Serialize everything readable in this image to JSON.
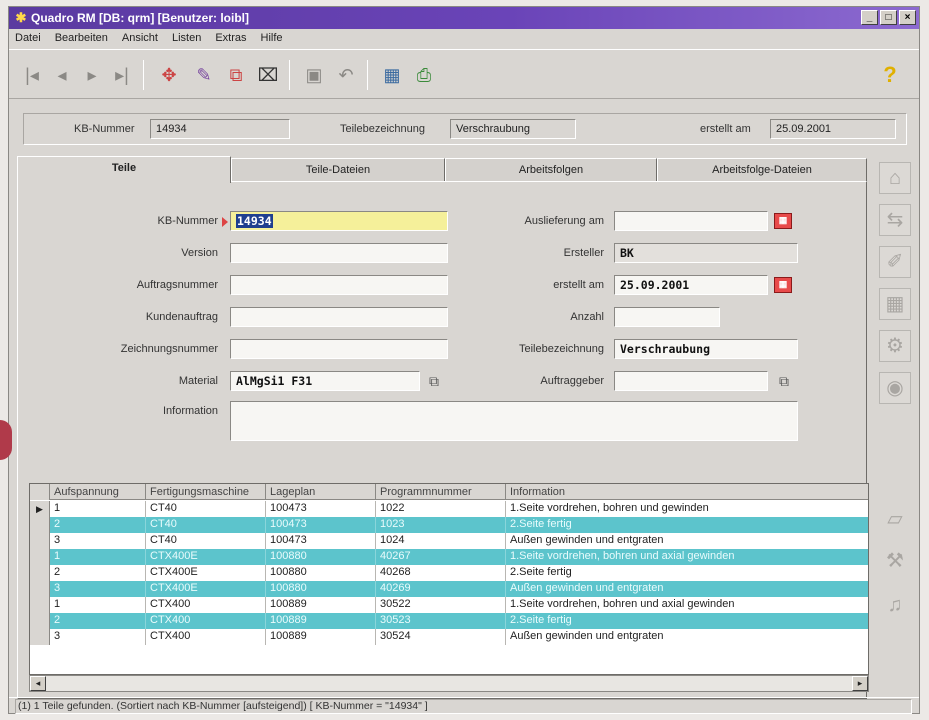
{
  "window": {
    "title": "Quadro RM  [DB: qrm] [Benutzer: loibl]",
    "controls": {
      "minimize": "_",
      "maximize": "□",
      "close": "×"
    }
  },
  "menu": [
    "Datei",
    "Bearbeiten",
    "Ansicht",
    "Listen",
    "Extras",
    "Hilfe"
  ],
  "toolbar": {
    "icons": [
      "first-record-icon",
      "prev-record-icon",
      "next-record-icon",
      "last-record-icon",
      "navigate-icon",
      "edit-icon",
      "copy-icon",
      "delete-icon",
      "save-icon",
      "undo-icon",
      "grid-view-icon",
      "print-icon",
      "help-icon"
    ]
  },
  "infobar": {
    "kb_label": "KB-Nummer",
    "kb_value": "14934",
    "teil_label": "Teilebezeichnung",
    "teil_value": "Verschraubung",
    "erstellt_label": "erstellt am",
    "erstellt_value": "25.09.2001"
  },
  "tabs": [
    "Teile",
    "Teile-Dateien",
    "Arbeitsfolgen",
    "Arbeitsfolge-Dateien"
  ],
  "form": {
    "left": [
      {
        "label": "KB-Nummer",
        "value": "14934"
      },
      {
        "label": "Version",
        "value": ""
      },
      {
        "label": "Auftragsnummer",
        "value": ""
      },
      {
        "label": "Kundenauftrag",
        "value": ""
      },
      {
        "label": "Zeichnungsnummer",
        "value": ""
      },
      {
        "label": "Material",
        "value": "AlMgSi1 F31"
      }
    ],
    "right": [
      {
        "label": "Auslieferung am",
        "value": ""
      },
      {
        "label": "Ersteller",
        "value": "BK"
      },
      {
        "label": "erstellt am",
        "value": "25.09.2001"
      },
      {
        "label": "Anzahl",
        "value": ""
      },
      {
        "label": "Teilebezeichnung",
        "value": "Verschraubung"
      },
      {
        "label": "Auftraggeber",
        "value": ""
      }
    ],
    "information_label": "Information",
    "information_value": ""
  },
  "grid": {
    "columns": [
      "Aufspannung",
      "Fertigungsmaschine",
      "Lageplan",
      "Programmnummer",
      "Information"
    ],
    "rows": [
      [
        "1",
        "CT40",
        "100473",
        "1022",
        "1.Seite vordrehen, bohren und gewinden"
      ],
      [
        "2",
        "CT40",
        "100473",
        "1023",
        "2.Seite fertig"
      ],
      [
        "3",
        "CT40",
        "100473",
        "1024",
        "Außen gewinden und entgraten"
      ],
      [
        "1",
        "CTX400E",
        "100880",
        "40267",
        "1.Seite vordrehen, bohren und axial gewinden"
      ],
      [
        "2",
        "CTX400E",
        "100880",
        "40268",
        "2.Seite fertig"
      ],
      [
        "3",
        "CTX400E",
        "100880",
        "40269",
        "Außen gewinden und entgraten"
      ],
      [
        "1",
        "CTX400",
        "100889",
        "30522",
        "1.Seite vordrehen, bohren und axial gewinden"
      ],
      [
        "2",
        "CTX400",
        "100889",
        "30523",
        "2.Seite fertig"
      ],
      [
        "3",
        "CTX400",
        "100889",
        "30524",
        "Außen gewinden und entgraten"
      ]
    ]
  },
  "status": "(1) 1 Teile gefunden. (Sortiert nach KB-Nummer [aufsteigend])    [ KB-Nummer = \"14934\" ]"
}
